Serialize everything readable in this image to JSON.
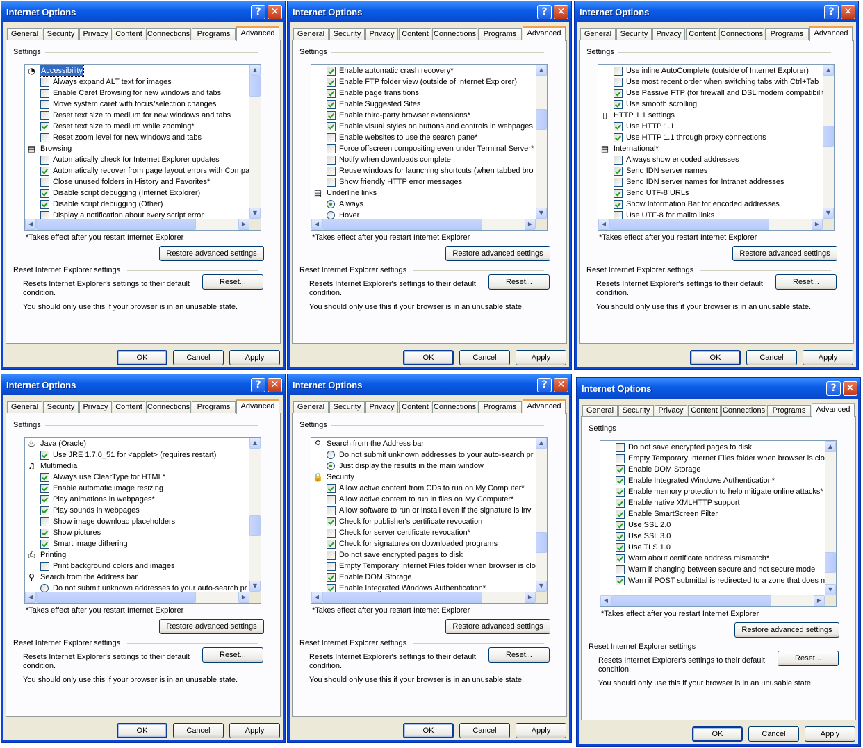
{
  "dialog": {
    "title": "Internet Options",
    "help_glyph": "?",
    "close_glyph": "✕",
    "tabs": [
      "General",
      "Security",
      "Privacy",
      "Content",
      "Connections",
      "Programs",
      "Advanced"
    ],
    "settings_label": "Settings",
    "restart_note": "*Takes effect after you restart Internet Explorer",
    "restore_button": "Restore advanced settings",
    "reset_group": "Reset Internet Explorer settings",
    "reset_desc": "Resets Internet Explorer's settings to their default condition.",
    "reset_button": "Reset...",
    "reset_warning": "You should only use this if your browser is in an unusable state.",
    "ok": "OK",
    "cancel": "Cancel",
    "apply": "Apply"
  },
  "windows": [
    {
      "scroll_fraction": 0.0,
      "items": [
        {
          "k": "cat",
          "icon": "accessibility-icon",
          "glyph": "◔",
          "label": "Accessibility",
          "selected": true
        },
        {
          "k": "cb",
          "on": false,
          "label": "Always expand ALT text for images"
        },
        {
          "k": "cb",
          "on": false,
          "label": "Enable Caret Browsing for new windows and tabs"
        },
        {
          "k": "cb",
          "on": false,
          "label": "Move system caret with focus/selection changes"
        },
        {
          "k": "cb",
          "on": false,
          "label": "Reset text size to medium for new windows and tabs"
        },
        {
          "k": "cb",
          "on": true,
          "label": "Reset text size to medium while zooming*"
        },
        {
          "k": "cb",
          "on": false,
          "label": "Reset zoom level for new windows and tabs"
        },
        {
          "k": "cat",
          "icon": "browsing-icon",
          "glyph": "▤",
          "label": "Browsing"
        },
        {
          "k": "cb",
          "on": false,
          "label": "Automatically check for Internet Explorer updates"
        },
        {
          "k": "cb",
          "on": true,
          "label": "Automatically recover from page layout errors with Compa"
        },
        {
          "k": "cb",
          "on": false,
          "label": "Close unused folders in History and Favorites*"
        },
        {
          "k": "cb",
          "on": true,
          "label": "Disable script debugging (Internet Explorer)"
        },
        {
          "k": "cb",
          "on": true,
          "label": "Disable script debugging (Other)"
        },
        {
          "k": "cb",
          "on": false,
          "label": "Display a notification about every script error"
        }
      ]
    },
    {
      "scroll_fraction": 0.3,
      "items": [
        {
          "k": "cb",
          "on": true,
          "label": "Enable automatic crash recovery*"
        },
        {
          "k": "cb",
          "on": true,
          "label": "Enable FTP folder view (outside of Internet Explorer)"
        },
        {
          "k": "cb",
          "on": true,
          "label": "Enable page transitions"
        },
        {
          "k": "cb",
          "on": true,
          "label": "Enable Suggested Sites"
        },
        {
          "k": "cb",
          "on": true,
          "label": "Enable third-party browser extensions*"
        },
        {
          "k": "cb",
          "on": true,
          "label": "Enable visual styles on buttons and controls in webpages"
        },
        {
          "k": "cb",
          "on": false,
          "label": "Enable websites to use the search pane*"
        },
        {
          "k": "cb",
          "on": false,
          "label": "Force offscreen compositing even under Terminal Server*"
        },
        {
          "k": "cb",
          "on": false,
          "label": "Notify when downloads complete"
        },
        {
          "k": "cb",
          "on": false,
          "label": "Reuse windows for launching shortcuts (when tabbed bro"
        },
        {
          "k": "cb",
          "on": false,
          "label": "Show friendly HTTP error messages"
        },
        {
          "k": "cat",
          "icon": "underline-links-icon",
          "glyph": "▤",
          "label": "Underline links"
        },
        {
          "k": "rb",
          "on": true,
          "label": "Always"
        },
        {
          "k": "rb",
          "on": false,
          "label": "Hover"
        }
      ]
    },
    {
      "scroll_fraction": 0.45,
      "items": [
        {
          "k": "cb",
          "on": false,
          "label": "Use inline AutoComplete (outside of Internet Explorer)"
        },
        {
          "k": "cb",
          "on": false,
          "label": "Use most recent order when switching tabs with Ctrl+Tab"
        },
        {
          "k": "cb",
          "on": true,
          "label": "Use Passive FTP (for firewall and DSL modem compatibility"
        },
        {
          "k": "cb",
          "on": true,
          "label": "Use smooth scrolling"
        },
        {
          "k": "cat",
          "icon": "http-settings-icon",
          "glyph": "▯",
          "label": "HTTP 1.1 settings"
        },
        {
          "k": "cb",
          "on": true,
          "label": "Use HTTP 1.1"
        },
        {
          "k": "cb",
          "on": true,
          "label": "Use HTTP 1.1 through proxy connections"
        },
        {
          "k": "cat",
          "icon": "international-icon",
          "glyph": "▤",
          "label": "International*"
        },
        {
          "k": "cb",
          "on": false,
          "label": "Always show encoded addresses"
        },
        {
          "k": "cb",
          "on": true,
          "label": "Send IDN server names"
        },
        {
          "k": "cb",
          "on": false,
          "label": "Send IDN server names for Intranet addresses"
        },
        {
          "k": "cb",
          "on": true,
          "label": "Send UTF-8 URLs"
        },
        {
          "k": "cb",
          "on": true,
          "label": "Show Information Bar for encoded addresses"
        },
        {
          "k": "cb",
          "on": false,
          "label": "Use UTF-8 for mailto links"
        }
      ]
    },
    {
      "scroll_fraction": 0.6,
      "items": [
        {
          "k": "cat",
          "icon": "java-icon",
          "glyph": "♨",
          "label": "Java (Oracle)"
        },
        {
          "k": "cb",
          "on": true,
          "label": "Use JRE 1.7.0_51 for <applet> (requires restart)"
        },
        {
          "k": "cat",
          "icon": "multimedia-icon",
          "glyph": "♫",
          "label": "Multimedia"
        },
        {
          "k": "cb",
          "on": true,
          "label": "Always use ClearType for HTML*"
        },
        {
          "k": "cb",
          "on": true,
          "label": "Enable automatic image resizing"
        },
        {
          "k": "cb",
          "on": true,
          "label": "Play animations in webpages*"
        },
        {
          "k": "cb",
          "on": true,
          "label": "Play sounds in webpages"
        },
        {
          "k": "cb",
          "on": false,
          "label": "Show image download placeholders"
        },
        {
          "k": "cb",
          "on": true,
          "label": "Show pictures"
        },
        {
          "k": "cb",
          "on": true,
          "label": "Smart image dithering"
        },
        {
          "k": "cat",
          "icon": "printer-icon",
          "glyph": "⎙",
          "label": "Printing"
        },
        {
          "k": "cb",
          "on": false,
          "label": "Print background colors and images"
        },
        {
          "k": "cat",
          "icon": "search-icon",
          "glyph": "⚲",
          "label": "Search from the Address bar"
        },
        {
          "k": "rb",
          "on": false,
          "label": "Do not submit unknown addresses to your auto-search pr"
        }
      ]
    },
    {
      "scroll_fraction": 0.75,
      "items": [
        {
          "k": "cat",
          "icon": "search-icon",
          "glyph": "⚲",
          "label": "Search from the Address bar"
        },
        {
          "k": "rb",
          "on": false,
          "label": "Do not submit unknown addresses to your auto-search pr"
        },
        {
          "k": "rb",
          "on": true,
          "label": "Just display the results in the main window"
        },
        {
          "k": "cat",
          "icon": "lock-icon",
          "glyph": "🔒",
          "label": "Security"
        },
        {
          "k": "cb",
          "on": true,
          "label": "Allow active content from CDs to run on My Computer*"
        },
        {
          "k": "cb",
          "on": false,
          "label": "Allow active content to run in files on My Computer*"
        },
        {
          "k": "cb",
          "on": false,
          "label": "Allow software to run or install even if the signature is inv"
        },
        {
          "k": "cb",
          "on": true,
          "label": "Check for publisher's certificate revocation"
        },
        {
          "k": "cb",
          "on": false,
          "label": "Check for server certificate revocation*"
        },
        {
          "k": "cb",
          "on": true,
          "label": "Check for signatures on downloaded programs"
        },
        {
          "k": "cb",
          "on": false,
          "label": "Do not save encrypted pages to disk"
        },
        {
          "k": "cb",
          "on": false,
          "label": "Empty Temporary Internet Files folder when browser is clo"
        },
        {
          "k": "cb",
          "on": true,
          "label": "Enable DOM Storage"
        },
        {
          "k": "cb",
          "on": true,
          "label": "Enable Integrated Windows Authentication*"
        }
      ]
    },
    {
      "scroll_fraction": 0.9,
      "items": [
        {
          "k": "cb",
          "on": false,
          "label": "Do not save encrypted pages to disk"
        },
        {
          "k": "cb",
          "on": false,
          "label": "Empty Temporary Internet Files folder when browser is clo"
        },
        {
          "k": "cb",
          "on": true,
          "label": "Enable DOM Storage"
        },
        {
          "k": "cb",
          "on": true,
          "label": "Enable Integrated Windows Authentication*"
        },
        {
          "k": "cb",
          "on": true,
          "label": "Enable memory protection to help mitigate online attacks*"
        },
        {
          "k": "cb",
          "on": true,
          "label": "Enable native XMLHTTP support"
        },
        {
          "k": "cb",
          "on": true,
          "label": "Enable SmartScreen Filter"
        },
        {
          "k": "cb",
          "on": true,
          "label": "Use SSL 2.0"
        },
        {
          "k": "cb",
          "on": true,
          "label": "Use SSL 3.0"
        },
        {
          "k": "cb",
          "on": true,
          "label": "Use TLS 1.0"
        },
        {
          "k": "cb",
          "on": true,
          "label": "Warn about certificate address mismatch*"
        },
        {
          "k": "cb",
          "on": false,
          "label": "Warn if changing between secure and not secure mode"
        },
        {
          "k": "cb",
          "on": true,
          "label": "Warn if POST submittal is redirected to a zone that does n"
        }
      ]
    }
  ]
}
